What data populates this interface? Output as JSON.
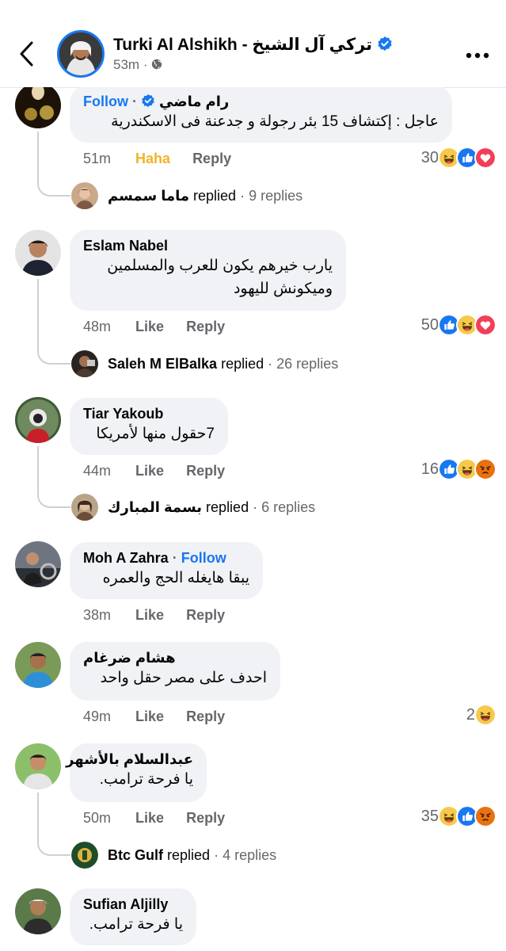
{
  "header": {
    "name": "Turki Al Alshikh - تركي آل الشيخ",
    "time": "53m"
  },
  "comments": [
    {
      "name": "رام ماضي",
      "follow": "Follow",
      "text": "عاجل : إكتشاف 15 بئر رجولة و جدعنة فى الاسكندرية",
      "time": "51m",
      "like": "Haha",
      "reply": "Reply",
      "count": "30",
      "reactions": [
        "haha",
        "like",
        "love"
      ],
      "replied": {
        "name": "ماما سمسم",
        "verb": "replied",
        "sep": "·",
        "count": "9 replies"
      }
    },
    {
      "name": "Eslam Nabel",
      "text_lines": [
        "يارب خيرهم يكون للعرب والمسلمين",
        "وميكونش لليهود"
      ],
      "time": "48m",
      "like": "Like",
      "reply": "Reply",
      "count": "50",
      "reactions": [
        "like",
        "haha",
        "love"
      ],
      "replied": {
        "name": "Saleh M ElBalka",
        "verb": "replied",
        "sep": "·",
        "count": "26 replies"
      }
    },
    {
      "name": "Tiar Yakoub",
      "text": "7حقول منها لأمريكا",
      "time": "44m",
      "like": "Like",
      "reply": "Reply",
      "count": "16",
      "reactions": [
        "like",
        "haha",
        "angry"
      ],
      "replied": {
        "name": "بسمة المبارك",
        "verb": "replied",
        "sep": "·",
        "count": "6 replies"
      }
    },
    {
      "name": "Moh A Zahra",
      "follow": "Follow",
      "text": "يبقا هايغله الحج والعمره",
      "time": "38m",
      "like": "Like",
      "reply": "Reply"
    },
    {
      "name": "هشام ضرغام",
      "text": "احدف على مصر حقل واحد",
      "time": "49m",
      "like": "Like",
      "reply": "Reply",
      "count": "2",
      "reactions": [
        "haha"
      ]
    },
    {
      "name": "عبدالسلام بالأشهر",
      "text": "يا فرحة ترامب.",
      "time": "50m",
      "like": "Like",
      "reply": "Reply",
      "count": "35",
      "reactions": [
        "haha",
        "like",
        "angry"
      ],
      "replied": {
        "name": "Btc Gulf",
        "verb": "replied",
        "sep": "·",
        "count": "4 replies"
      }
    },
    {
      "name": "Sufian Aljilly",
      "text": "يا فرحة ترامب."
    }
  ],
  "colors": {
    "accent": "#1877f2",
    "haha": "#f0b429",
    "bubble": "#f0f2f5",
    "muted": "#65676b",
    "love": "#f33e58",
    "angry": "#e9710f"
  }
}
